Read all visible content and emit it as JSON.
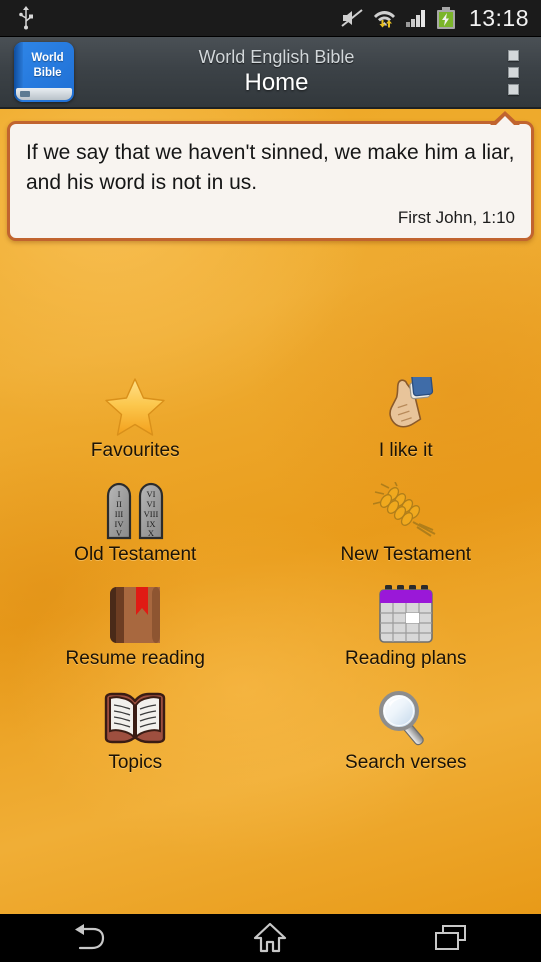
{
  "status_bar": {
    "time": "13:18",
    "icons": [
      {
        "name": "usb-icon",
        "position": "left"
      },
      {
        "name": "mute-icon",
        "position": "right"
      },
      {
        "name": "wifi-data-transfer-icon",
        "position": "right"
      },
      {
        "name": "signal-bars-icon",
        "position": "right"
      },
      {
        "name": "battery-charging-icon",
        "position": "right"
      }
    ]
  },
  "action_bar": {
    "app_icon_line1": "World",
    "app_icon_line2": "Bible",
    "title": "World English Bible",
    "subtitle": "Home",
    "overflow_label": "More options"
  },
  "verse_card": {
    "text": "If we say that we haven't sinned, we make him a liar, and his word is not in us.",
    "reference": "First John, 1:10"
  },
  "menu": {
    "items": [
      {
        "label": "Favourites",
        "icon": "star-icon"
      },
      {
        "label": "I like it",
        "icon": "thumbs-up-icon"
      },
      {
        "label": "Old Testament",
        "icon": "ten-commandments-tablets-icon"
      },
      {
        "label": "New Testament",
        "icon": "wheat-stalk-icon"
      },
      {
        "label": "Resume reading",
        "icon": "bookmarked-book-icon"
      },
      {
        "label": "Reading plans",
        "icon": "calendar-icon"
      },
      {
        "label": "Topics",
        "icon": "open-book-icon"
      },
      {
        "label": "Search verses",
        "icon": "magnifying-glass-icon"
      }
    ]
  },
  "tablets": {
    "left_numerals": [
      "I",
      "II",
      "III",
      "IV",
      "V"
    ],
    "right_numerals": [
      "VI",
      "VI",
      "VIII",
      "IX",
      "X"
    ]
  },
  "nav_bar": {
    "back_label": "Back",
    "home_label": "Home",
    "recents_label": "Recent apps"
  },
  "colors": {
    "background_orange": "#eda723",
    "card_border": "#c1642f",
    "card_fill": "#f8f4f0",
    "action_bar": "#3c4247",
    "status_bar": "#1b1b1b",
    "accent_blue": "#2f86e8"
  }
}
